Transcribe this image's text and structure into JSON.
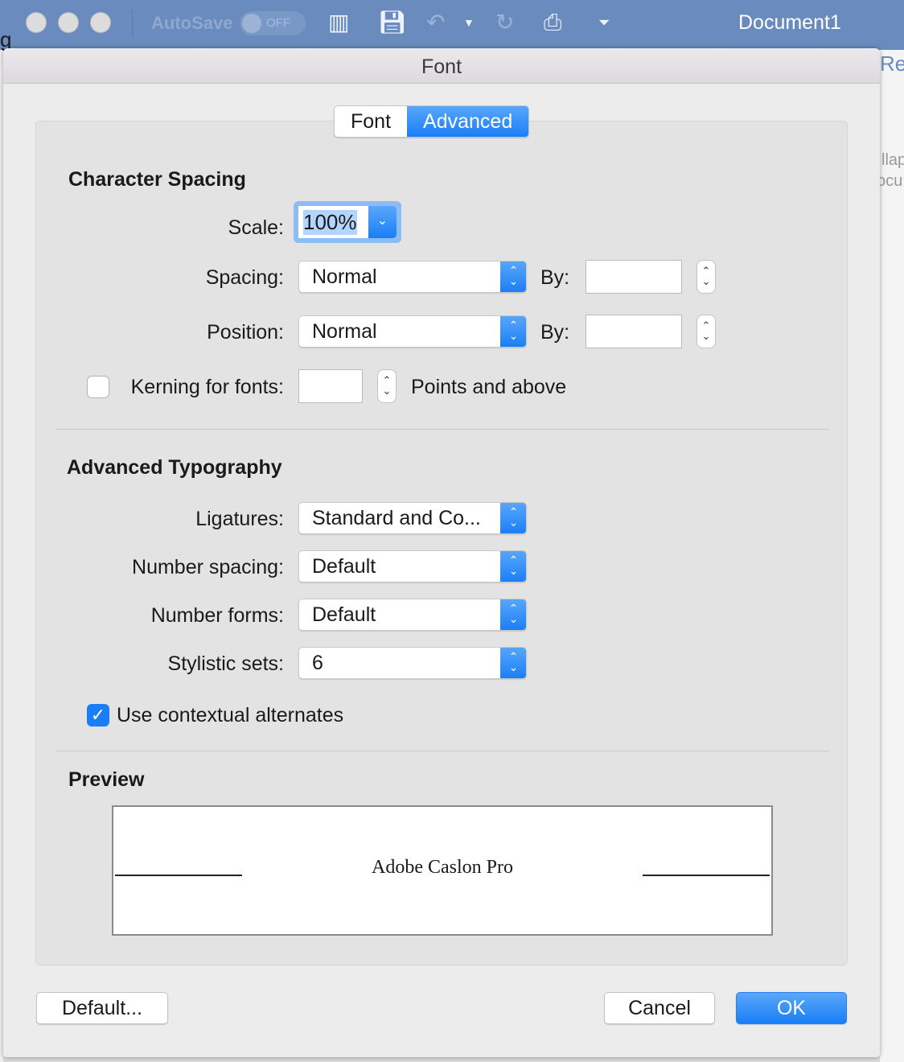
{
  "app": {
    "title": "Document1",
    "autosave_label": "AutoSave",
    "autosave_state": "OFF",
    "bg_fragments": [
      "g",
      "Re",
      "llap",
      "ocu"
    ]
  },
  "dialog": {
    "title": "Font",
    "tabs": [
      {
        "label": "Font",
        "selected": false
      },
      {
        "label": "Advanced",
        "selected": true
      }
    ],
    "character_spacing": {
      "heading": "Character Spacing",
      "scale_label": "Scale:",
      "scale_value": "100%",
      "spacing_label": "Spacing:",
      "spacing_value": "Normal",
      "spacing_by_label": "By:",
      "spacing_by_value": "",
      "position_label": "Position:",
      "position_value": "Normal",
      "position_by_label": "By:",
      "position_by_value": "",
      "kerning_label": "Kerning for fonts:",
      "kerning_checked": false,
      "kerning_value": "",
      "kerning_suffix": "Points and above"
    },
    "advanced_typography": {
      "heading": "Advanced Typography",
      "ligatures_label": "Ligatures:",
      "ligatures_value": "Standard and Co...",
      "number_spacing_label": "Number spacing:",
      "number_spacing_value": "Default",
      "number_forms_label": "Number forms:",
      "number_forms_value": "Default",
      "stylistic_sets_label": "Stylistic sets:",
      "stylistic_sets_value": "6",
      "contextual_label": "Use contextual alternates",
      "contextual_checked": true
    },
    "preview": {
      "heading": "Preview",
      "text": "Adobe Caslon Pro"
    },
    "buttons": {
      "default": "Default...",
      "cancel": "Cancel",
      "ok": "OK"
    }
  },
  "colors": {
    "accent": "#1a7ef6",
    "titlebar": "#6a8bbd"
  }
}
